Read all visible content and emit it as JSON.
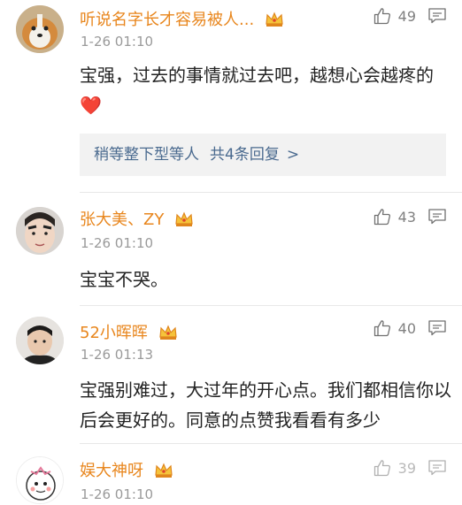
{
  "comments": [
    {
      "name": "听说名字长才容易被人...",
      "time": "1-26 01:10",
      "likes": "49",
      "text": "宝强，过去的事情就过去吧，越想心会越疼的",
      "heart": "❤️",
      "sub_replies": {
        "users": "稍等整下型等人",
        "total": "共4条回复",
        "chevron": ">"
      }
    },
    {
      "name": "张大美、ZY",
      "time": "1-26 01:10",
      "likes": "43",
      "text": "宝宝不哭。"
    },
    {
      "name": "52小晖晖",
      "time": "1-26 01:13",
      "likes": "40",
      "text": "宝强别难过，大过年的开心点。我们都相信你以后会更好的。同意的点赞我看看有多少"
    },
    {
      "name": "娱大神呀",
      "time": "1-26 01:10",
      "likes": "39"
    }
  ],
  "colors": {
    "name": "#e8861d",
    "link": "#4a6a8f",
    "muted": "#9a9a9a"
  },
  "icons": {
    "like": "thumbs-up-icon",
    "reply": "comment-icon",
    "vip": "crown-icon"
  }
}
